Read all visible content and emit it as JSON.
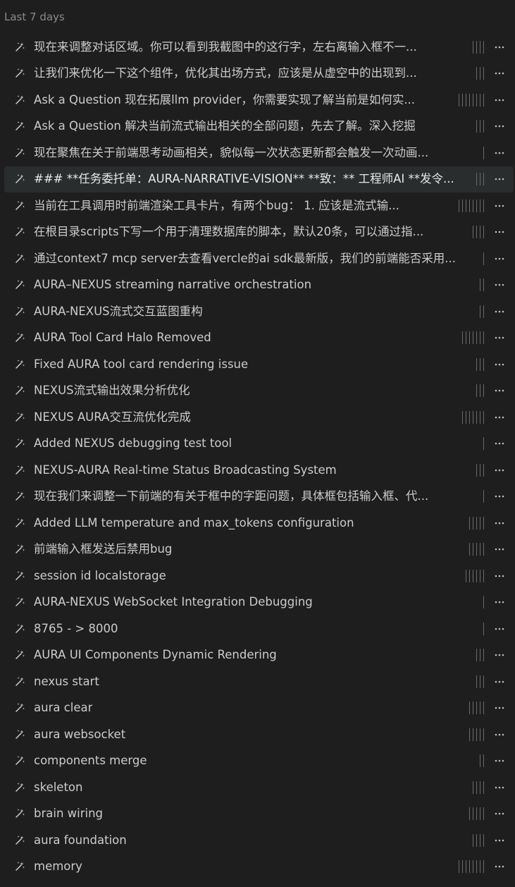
{
  "section": {
    "header": "Last 7 days"
  },
  "colors": {
    "background": "#1e1e1e",
    "selected_row": "#2a2d2e",
    "text": "#cccccc",
    "muted": "#8b8b8b",
    "tick": "#6a6a6a"
  },
  "icons": {
    "item": "sparkle-wand-icon",
    "more": "more-horizontal-icon"
  },
  "items": [
    {
      "title": "现在来调整对话区域。你可以看到我截图中的这行字，左右离输入框不一...",
      "ticks": 4,
      "selected": false
    },
    {
      "title": "让我们来优化一下这个组件，优化其出场方式，应该是从虚空中的出现到...",
      "ticks": 3,
      "selected": false
    },
    {
      "title": "Ask a Question 现在拓展llm provider，你需要实现了解当前是如何实...",
      "ticks": 8,
      "selected": false
    },
    {
      "title": "Ask a Question 解决当前流式输出相关的全部问题，先去了解。深入挖掘",
      "ticks": 3,
      "selected": false
    },
    {
      "title": "现在聚焦在关于前端思考动画相关，貌似每一次状态更新都会触发一次动画...",
      "ticks": 1,
      "selected": false
    },
    {
      "title": "### **任务委托单：AURA-NARRATIVE-VISION** **致：** 工程师AI **发令...",
      "ticks": 3,
      "selected": true
    },
    {
      "title": "当前在工具调用时前端渲染工具卡片，有两个bug： 1. 应该是流式输...",
      "ticks": 8,
      "selected": false
    },
    {
      "title": "在根目录scripts下写一个用于清理数据库的脚本，默认20条，可以通过指...",
      "ticks": 4,
      "selected": false
    },
    {
      "title": "通过context7 mcp server去查看vercle的ai sdk最新版，我们的前端能否采用...",
      "ticks": 1,
      "selected": false
    },
    {
      "title": "AURA–NEXUS streaming narrative orchestration",
      "ticks": 2,
      "selected": false
    },
    {
      "title": "AURA-NEXUS流式交互蓝图重构",
      "ticks": 2,
      "selected": false
    },
    {
      "title": "AURA Tool Card Halo Removed",
      "ticks": 7,
      "selected": false
    },
    {
      "title": "Fixed AURA tool card rendering issue",
      "ticks": 3,
      "selected": false
    },
    {
      "title": "NEXUS流式输出效果分析优化",
      "ticks": 3,
      "selected": false
    },
    {
      "title": "NEXUS AURA交互流优化完成",
      "ticks": 7,
      "selected": false
    },
    {
      "title": "Added NEXUS debugging test tool",
      "ticks": 1,
      "selected": false
    },
    {
      "title": "NEXUS-AURA Real-time Status Broadcasting System",
      "ticks": 3,
      "selected": false
    },
    {
      "title": "现在我们来调整一下前端的有关于框中的字距问题，具体框包括输入框、代...",
      "ticks": 1,
      "selected": false
    },
    {
      "title": "Added LLM temperature and max_tokens configuration",
      "ticks": 5,
      "selected": false
    },
    {
      "title": "前端输入框发送后禁用bug",
      "ticks": 5,
      "selected": false
    },
    {
      "title": "session id localstorage",
      "ticks": 6,
      "selected": false
    },
    {
      "title": "AURA-NEXUS WebSocket Integration Debugging",
      "ticks": 1,
      "selected": false
    },
    {
      "title": "8765 - > 8000",
      "ticks": 1,
      "selected": false
    },
    {
      "title": "AURA UI Components Dynamic Rendering",
      "ticks": 3,
      "selected": false
    },
    {
      "title": "nexus start",
      "ticks": 3,
      "selected": false
    },
    {
      "title": "aura clear",
      "ticks": 5,
      "selected": false
    },
    {
      "title": "aura websocket",
      "ticks": 5,
      "selected": false
    },
    {
      "title": "components merge",
      "ticks": 2,
      "selected": false
    },
    {
      "title": "skeleton",
      "ticks": 4,
      "selected": false
    },
    {
      "title": "brain wiring",
      "ticks": 5,
      "selected": false
    },
    {
      "title": "aura foundation",
      "ticks": 4,
      "selected": false
    },
    {
      "title": "memory",
      "ticks": 8,
      "selected": false
    }
  ]
}
